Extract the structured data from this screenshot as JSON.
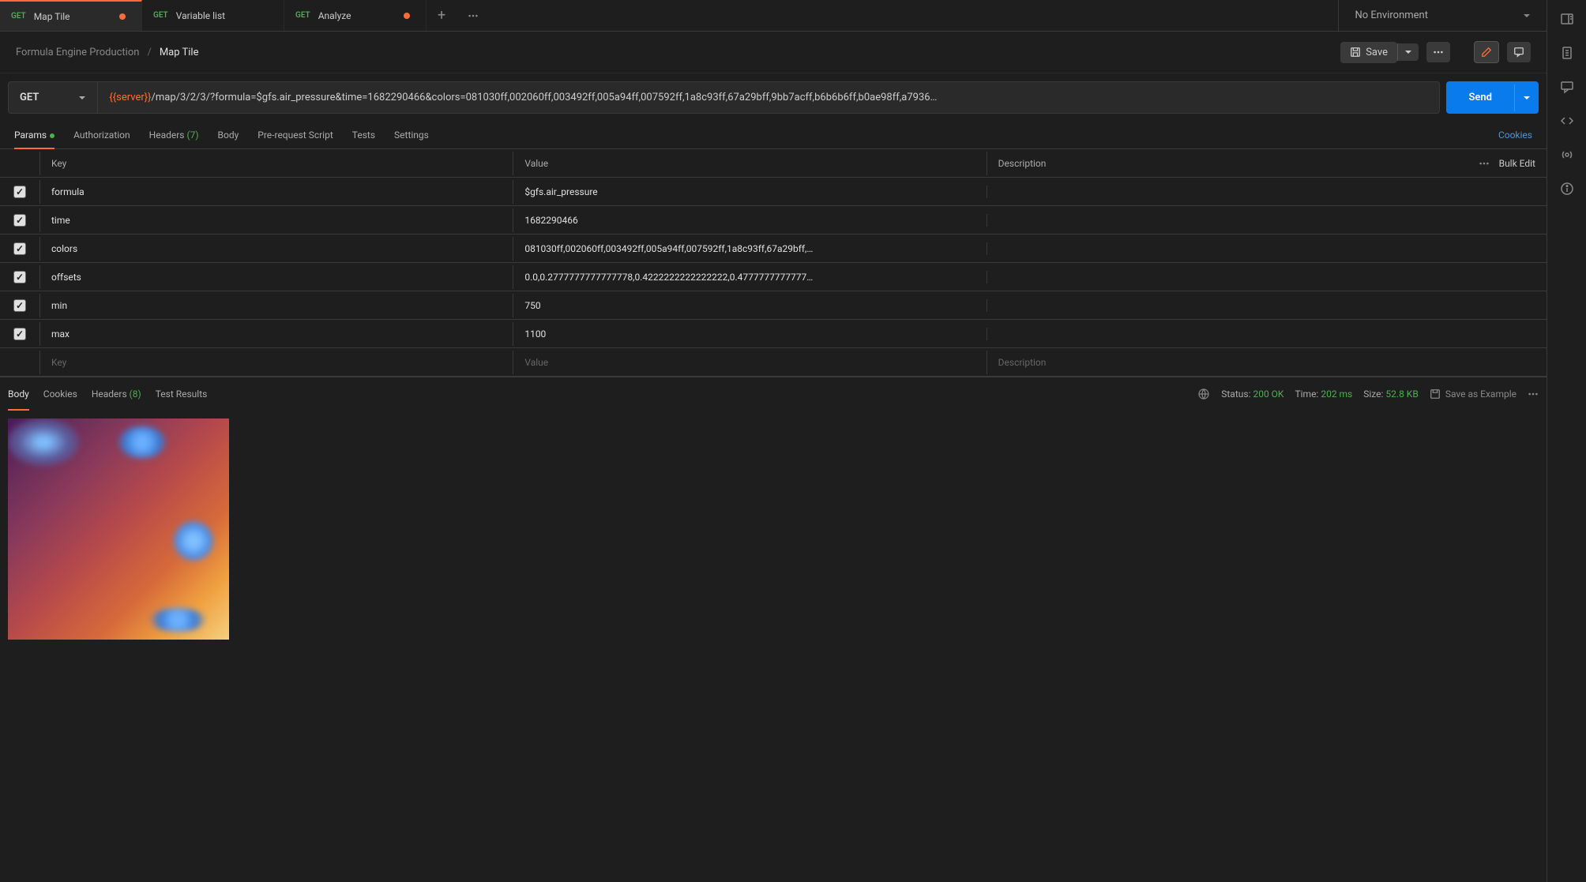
{
  "tabs": [
    {
      "method": "GET",
      "name": "Map Tile",
      "modified": true,
      "active": true
    },
    {
      "method": "GET",
      "name": "Variable list",
      "modified": false,
      "active": false
    },
    {
      "method": "GET",
      "name": "Analyze",
      "modified": true,
      "active": false
    }
  ],
  "environment": {
    "selected": "No Environment"
  },
  "breadcrumb": {
    "parent": "Formula Engine Production",
    "current": "Map Tile"
  },
  "actions": {
    "save": "Save",
    "send": "Send"
  },
  "request": {
    "method": "GET",
    "url_var": "{{server}}",
    "url_path": "/map/3/2/3/?formula=$gfs.air_pressure&time=1682290466&colors=081030ff,002060ff,003492ff,005a94ff,007592ff,1a8c93ff,67a29bff,9bb7acff,b6b6b6ff,b0ae98ff,a7936…"
  },
  "request_tabs": {
    "params": "Params",
    "authorization": "Authorization",
    "headers": "Headers",
    "headers_count": "(7)",
    "body": "Body",
    "pre_request": "Pre-request Script",
    "tests": "Tests",
    "settings": "Settings",
    "cookies": "Cookies"
  },
  "params_table": {
    "headers": {
      "key": "Key",
      "value": "Value",
      "description": "Description",
      "bulk_edit": "Bulk Edit"
    },
    "rows": [
      {
        "checked": true,
        "key": "formula",
        "value": "$gfs.air_pressure",
        "description": ""
      },
      {
        "checked": true,
        "key": "time",
        "value": "1682290466",
        "description": ""
      },
      {
        "checked": true,
        "key": "colors",
        "value": "081030ff,002060ff,003492ff,005a94ff,007592ff,1a8c93ff,67a29bff,…",
        "description": ""
      },
      {
        "checked": true,
        "key": "offsets",
        "value": "0.0,0.2777777777777778,0.4222222222222222,0.4777777777777…",
        "description": ""
      },
      {
        "checked": true,
        "key": "min",
        "value": "750",
        "description": ""
      },
      {
        "checked": true,
        "key": "max",
        "value": "1100",
        "description": ""
      }
    ],
    "placeholder": {
      "key": "Key",
      "value": "Value",
      "description": "Description"
    }
  },
  "response_tabs": {
    "body": "Body",
    "cookies": "Cookies",
    "headers": "Headers",
    "headers_count": "(8)",
    "test_results": "Test Results"
  },
  "response_meta": {
    "status_label": "Status:",
    "status_code": "200",
    "status_text": "OK",
    "time_label": "Time:",
    "time_value": "202 ms",
    "size_label": "Size:",
    "size_value": "52.8 KB",
    "save_example": "Save as Example"
  }
}
